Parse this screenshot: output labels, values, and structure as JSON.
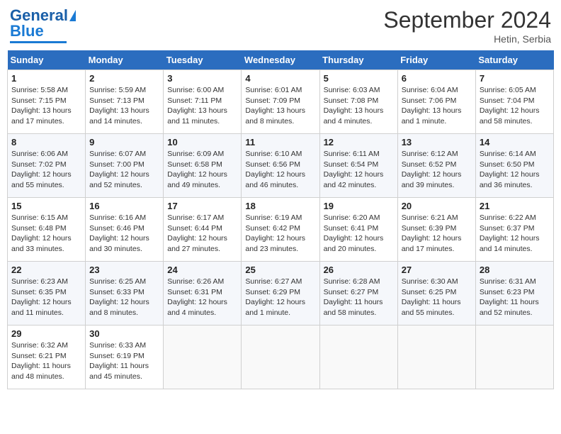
{
  "logo": {
    "line1": "General",
    "line2": "Blue"
  },
  "title": "September 2024",
  "location": "Hetin, Serbia",
  "days_header": [
    "Sunday",
    "Monday",
    "Tuesday",
    "Wednesday",
    "Thursday",
    "Friday",
    "Saturday"
  ],
  "weeks": [
    [
      {
        "day": "1",
        "info": "Sunrise: 5:58 AM\nSunset: 7:15 PM\nDaylight: 13 hours and 17 minutes."
      },
      {
        "day": "2",
        "info": "Sunrise: 5:59 AM\nSunset: 7:13 PM\nDaylight: 13 hours and 14 minutes."
      },
      {
        "day": "3",
        "info": "Sunrise: 6:00 AM\nSunset: 7:11 PM\nDaylight: 13 hours and 11 minutes."
      },
      {
        "day": "4",
        "info": "Sunrise: 6:01 AM\nSunset: 7:09 PM\nDaylight: 13 hours and 8 minutes."
      },
      {
        "day": "5",
        "info": "Sunrise: 6:03 AM\nSunset: 7:08 PM\nDaylight: 13 hours and 4 minutes."
      },
      {
        "day": "6",
        "info": "Sunrise: 6:04 AM\nSunset: 7:06 PM\nDaylight: 13 hours and 1 minute."
      },
      {
        "day": "7",
        "info": "Sunrise: 6:05 AM\nSunset: 7:04 PM\nDaylight: 12 hours and 58 minutes."
      }
    ],
    [
      {
        "day": "8",
        "info": "Sunrise: 6:06 AM\nSunset: 7:02 PM\nDaylight: 12 hours and 55 minutes."
      },
      {
        "day": "9",
        "info": "Sunrise: 6:07 AM\nSunset: 7:00 PM\nDaylight: 12 hours and 52 minutes."
      },
      {
        "day": "10",
        "info": "Sunrise: 6:09 AM\nSunset: 6:58 PM\nDaylight: 12 hours and 49 minutes."
      },
      {
        "day": "11",
        "info": "Sunrise: 6:10 AM\nSunset: 6:56 PM\nDaylight: 12 hours and 46 minutes."
      },
      {
        "day": "12",
        "info": "Sunrise: 6:11 AM\nSunset: 6:54 PM\nDaylight: 12 hours and 42 minutes."
      },
      {
        "day": "13",
        "info": "Sunrise: 6:12 AM\nSunset: 6:52 PM\nDaylight: 12 hours and 39 minutes."
      },
      {
        "day": "14",
        "info": "Sunrise: 6:14 AM\nSunset: 6:50 PM\nDaylight: 12 hours and 36 minutes."
      }
    ],
    [
      {
        "day": "15",
        "info": "Sunrise: 6:15 AM\nSunset: 6:48 PM\nDaylight: 12 hours and 33 minutes."
      },
      {
        "day": "16",
        "info": "Sunrise: 6:16 AM\nSunset: 6:46 PM\nDaylight: 12 hours and 30 minutes."
      },
      {
        "day": "17",
        "info": "Sunrise: 6:17 AM\nSunset: 6:44 PM\nDaylight: 12 hours and 27 minutes."
      },
      {
        "day": "18",
        "info": "Sunrise: 6:19 AM\nSunset: 6:42 PM\nDaylight: 12 hours and 23 minutes."
      },
      {
        "day": "19",
        "info": "Sunrise: 6:20 AM\nSunset: 6:41 PM\nDaylight: 12 hours and 20 minutes."
      },
      {
        "day": "20",
        "info": "Sunrise: 6:21 AM\nSunset: 6:39 PM\nDaylight: 12 hours and 17 minutes."
      },
      {
        "day": "21",
        "info": "Sunrise: 6:22 AM\nSunset: 6:37 PM\nDaylight: 12 hours and 14 minutes."
      }
    ],
    [
      {
        "day": "22",
        "info": "Sunrise: 6:23 AM\nSunset: 6:35 PM\nDaylight: 12 hours and 11 minutes."
      },
      {
        "day": "23",
        "info": "Sunrise: 6:25 AM\nSunset: 6:33 PM\nDaylight: 12 hours and 8 minutes."
      },
      {
        "day": "24",
        "info": "Sunrise: 6:26 AM\nSunset: 6:31 PM\nDaylight: 12 hours and 4 minutes."
      },
      {
        "day": "25",
        "info": "Sunrise: 6:27 AM\nSunset: 6:29 PM\nDaylight: 12 hours and 1 minute."
      },
      {
        "day": "26",
        "info": "Sunrise: 6:28 AM\nSunset: 6:27 PM\nDaylight: 11 hours and 58 minutes."
      },
      {
        "day": "27",
        "info": "Sunrise: 6:30 AM\nSunset: 6:25 PM\nDaylight: 11 hours and 55 minutes."
      },
      {
        "day": "28",
        "info": "Sunrise: 6:31 AM\nSunset: 6:23 PM\nDaylight: 11 hours and 52 minutes."
      }
    ],
    [
      {
        "day": "29",
        "info": "Sunrise: 6:32 AM\nSunset: 6:21 PM\nDaylight: 11 hours and 48 minutes."
      },
      {
        "day": "30",
        "info": "Sunrise: 6:33 AM\nSunset: 6:19 PM\nDaylight: 11 hours and 45 minutes."
      },
      {
        "day": "",
        "info": ""
      },
      {
        "day": "",
        "info": ""
      },
      {
        "day": "",
        "info": ""
      },
      {
        "day": "",
        "info": ""
      },
      {
        "day": "",
        "info": ""
      }
    ]
  ]
}
